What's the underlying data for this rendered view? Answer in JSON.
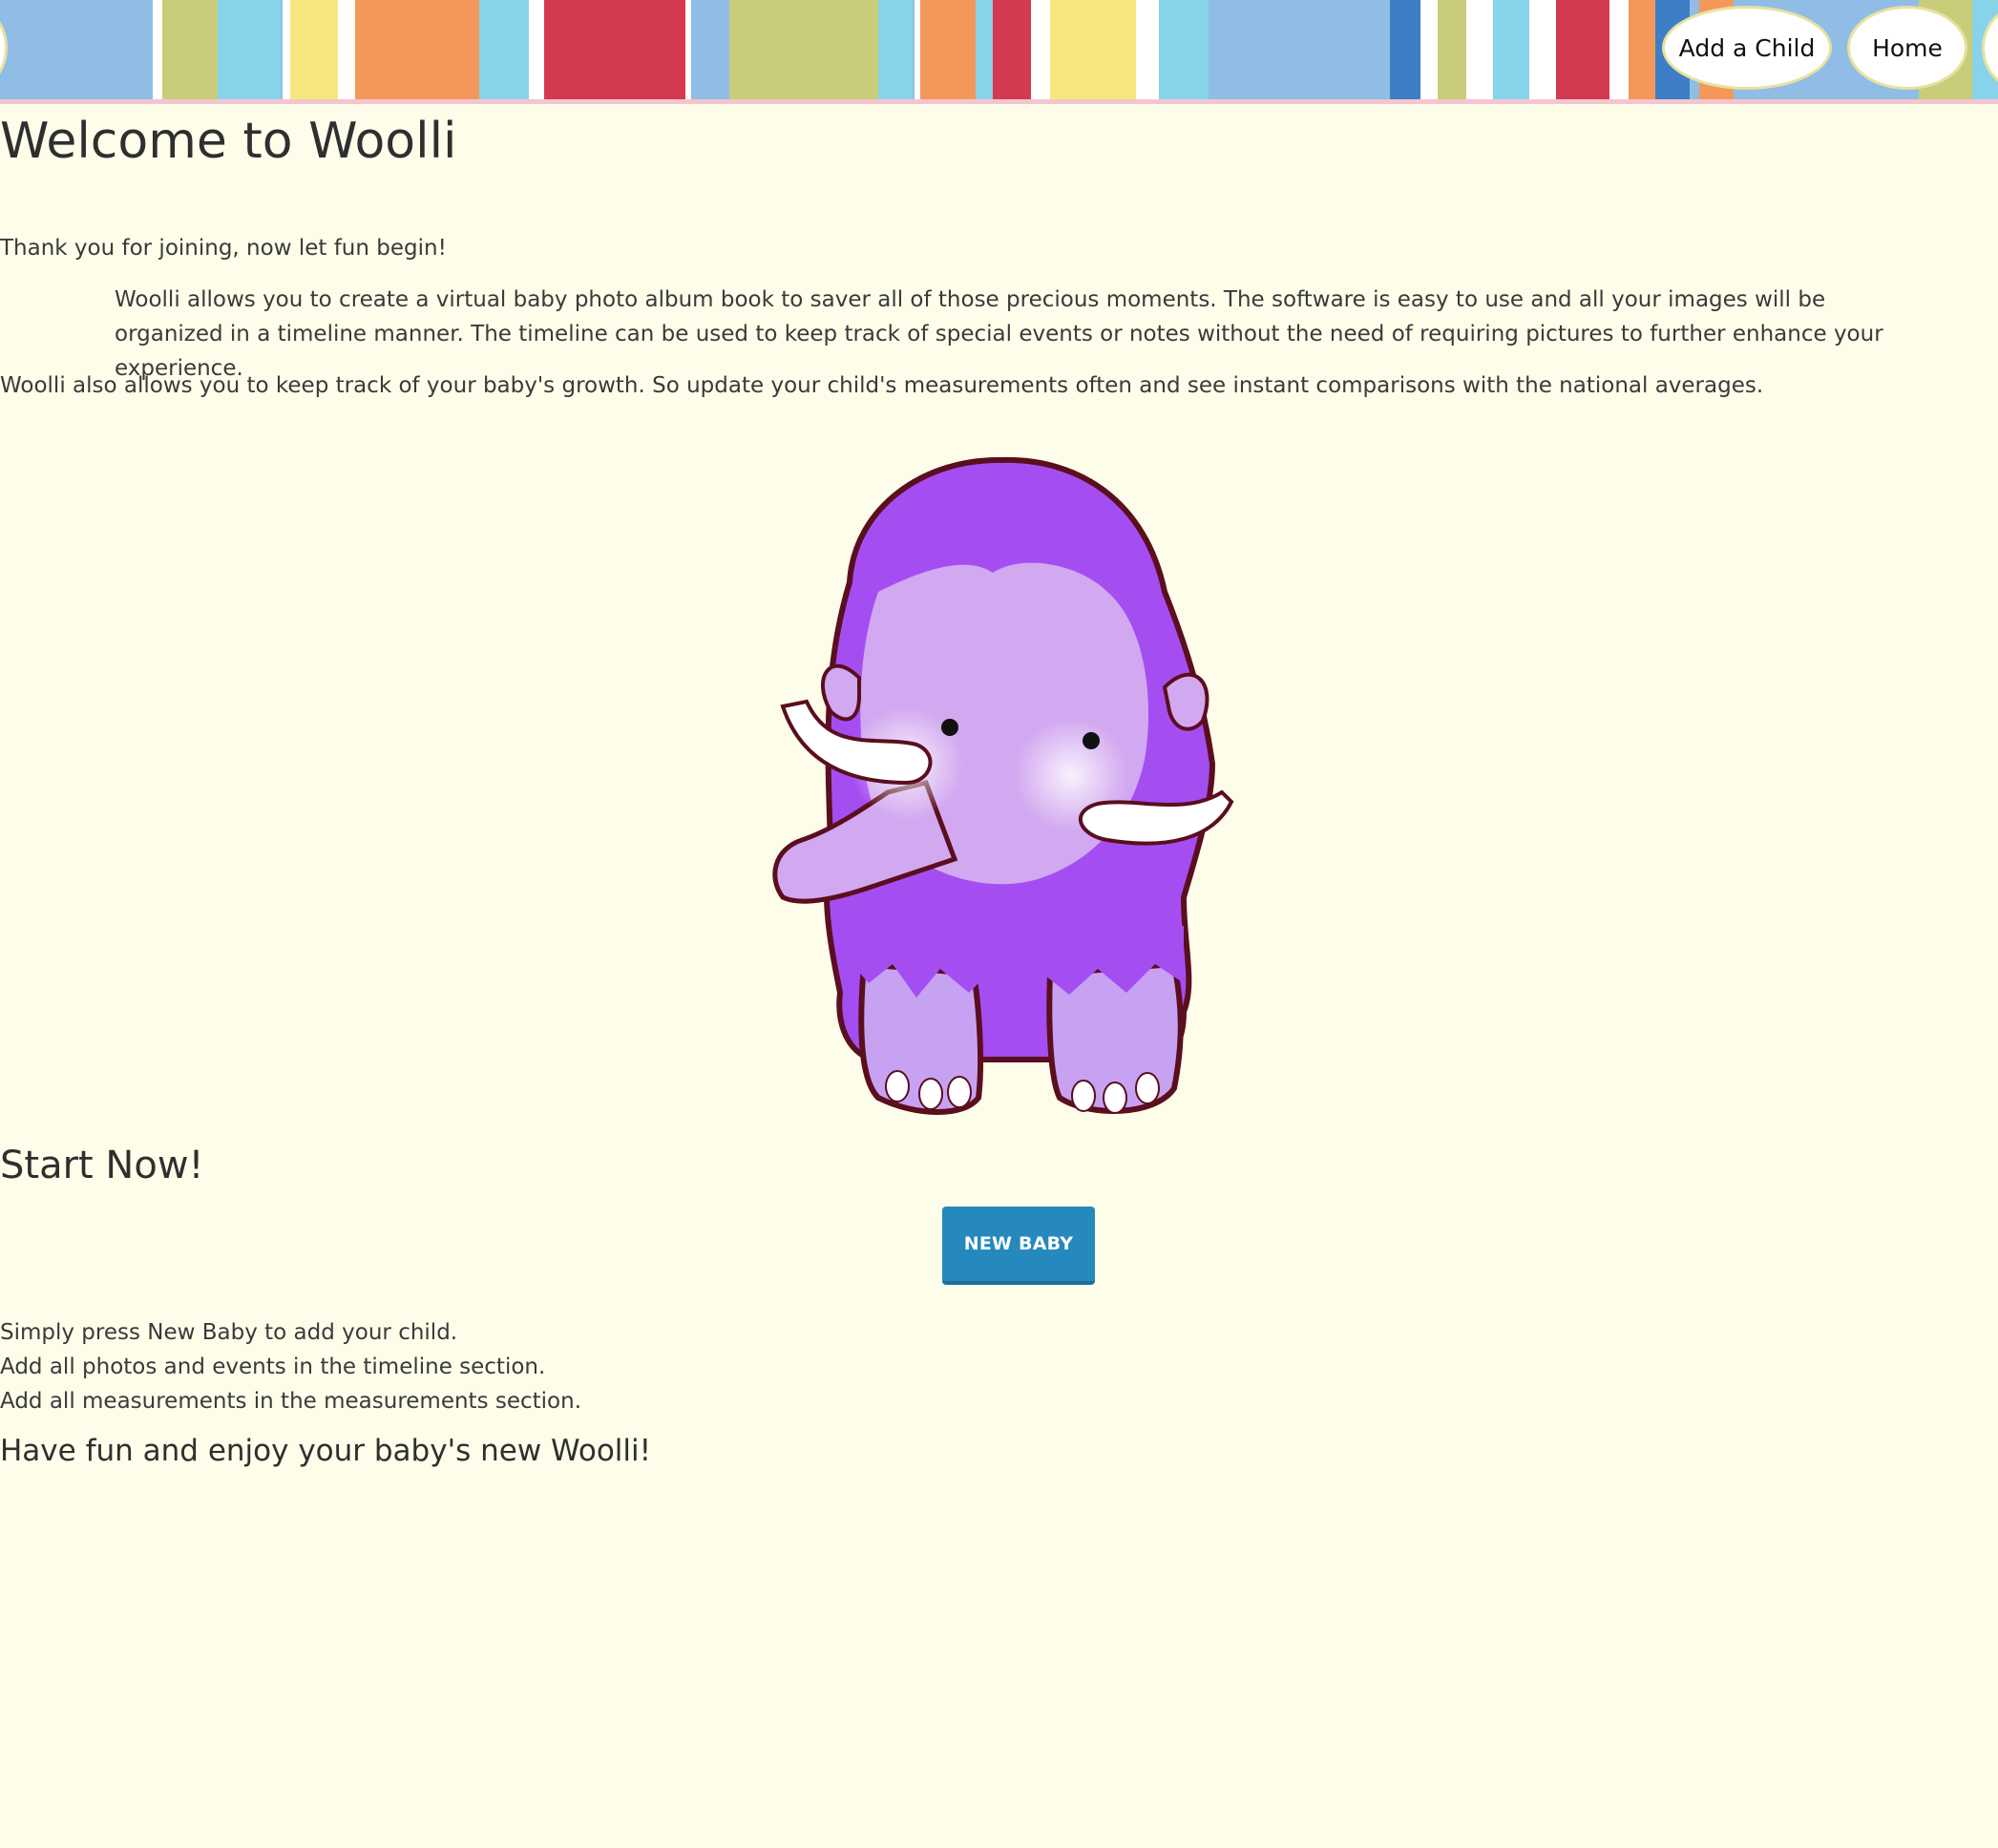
{
  "colors": {
    "background": "#fdfdea",
    "button": "#2589bd",
    "banner_border": "#f4c5cf",
    "mascot_fur": "#a44ef2",
    "mascot_face": "#d2a8f0"
  },
  "nav": {
    "add_child": "Add a Child",
    "home": "Home"
  },
  "main": {
    "title": "Welcome to Woolli",
    "intro": "Thank you for joining, now let fun begin!",
    "paragraph1": "Woolli allows you to create a virtual baby photo album book to saver all of those precious moments. The software is easy to use and all your images will be organized in a timeline manner. The timeline can be used to keep track of special events or notes without the need of requiring pictures to further enhance your experience.",
    "paragraph2": "Woolli also allows you to keep track of your baby's growth. So update your child's measurements often and see instant comparisons with the national averages.",
    "mascot_icon": "woolly-mammoth-icon",
    "start_heading": "Start Now!",
    "new_baby_button": "NEW BABY",
    "instructions": [
      "Simply press New Baby to add your child.",
      "Add all photos and events in the timeline section.",
      "Add all measurements in the measurements section."
    ],
    "closing": "Have fun and enjoy your baby's new Woolli!"
  }
}
